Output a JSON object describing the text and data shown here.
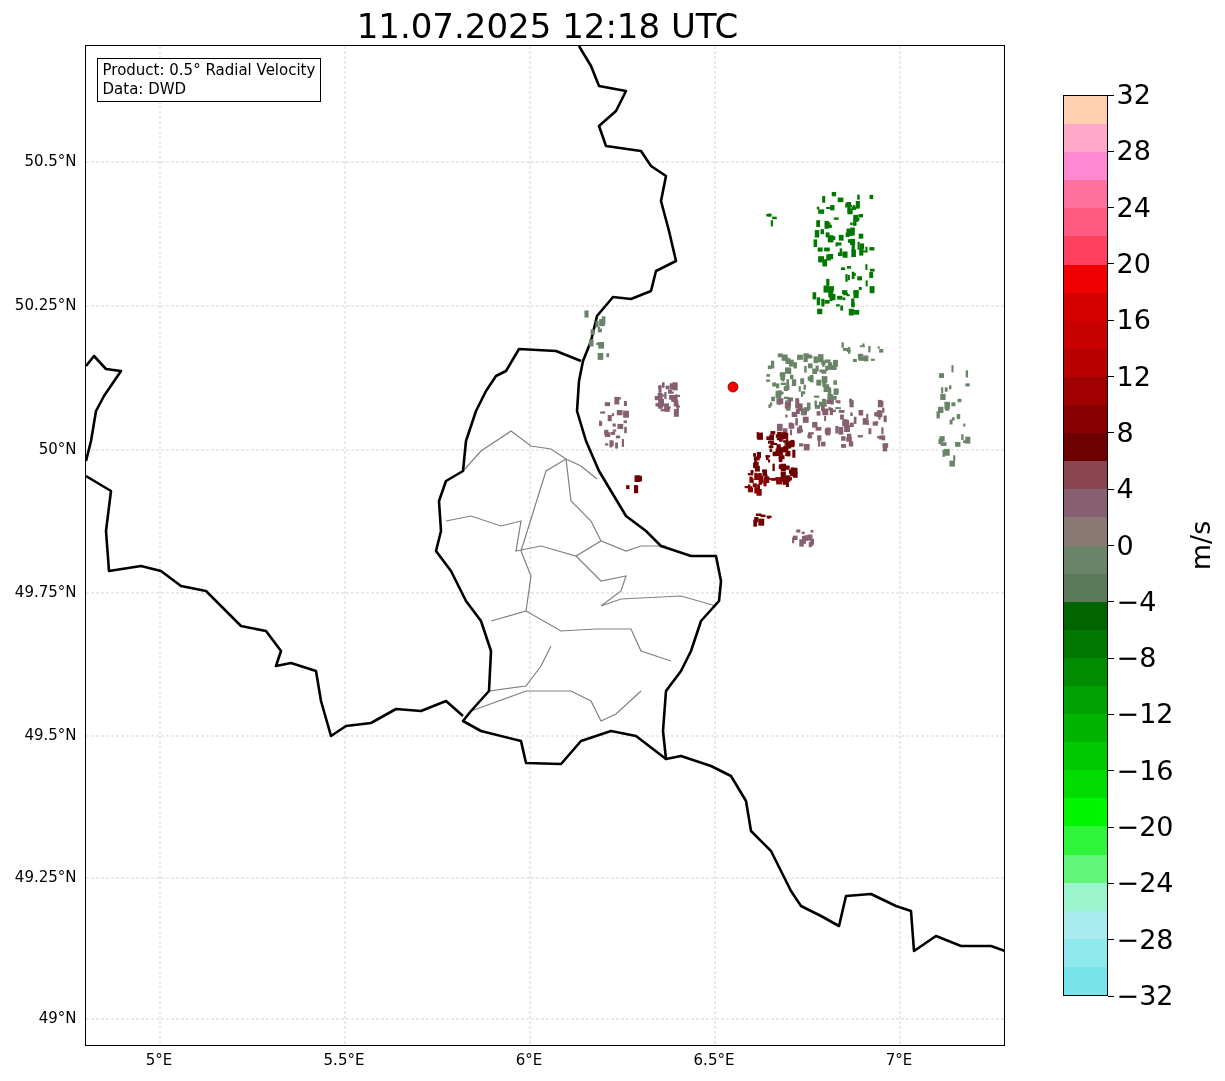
{
  "title": "11.07.2025 12:18 UTC",
  "map": {
    "info_box": [
      "Product: 0.5° Radial Velocity",
      "Data: DWD"
    ],
    "y_ticks": [
      "50.5°N",
      "50.25°N",
      "50°N",
      "49.75°N",
      "49.5°N",
      "49.25°N",
      "49°N"
    ],
    "x_ticks": [
      "5°E",
      "5.5°E",
      "6°E",
      "6.5°E",
      "7°E"
    ]
  },
  "colorbar": {
    "label": "m/s",
    "ticks": [
      "32",
      "28",
      "24",
      "20",
      "16",
      "12",
      "8",
      "4",
      "0",
      "−4",
      "−8",
      "−12",
      "−16",
      "−20",
      "−24",
      "−28",
      "−32"
    ],
    "bands": [
      {
        "color": "#ffd0b0"
      },
      {
        "color": "#ffa8c8"
      },
      {
        "color": "#ff88d0"
      },
      {
        "color": "#ff72a0"
      },
      {
        "color": "#ff5a80"
      },
      {
        "color": "#ff4060"
      },
      {
        "color": "#f00000"
      },
      {
        "color": "#d60000"
      },
      {
        "color": "#c80000"
      },
      {
        "color": "#b80000"
      },
      {
        "color": "#a00000"
      },
      {
        "color": "#880000"
      },
      {
        "color": "#6e0000"
      },
      {
        "color": "#8a4650"
      },
      {
        "color": "#866070"
      },
      {
        "color": "#8a7874"
      },
      {
        "color": "#6a8468"
      },
      {
        "color": "#5a7a5a"
      },
      {
        "color": "#006400"
      },
      {
        "color": "#007800"
      },
      {
        "color": "#008c00"
      },
      {
        "color": "#00a000"
      },
      {
        "color": "#00b400"
      },
      {
        "color": "#00c800"
      },
      {
        "color": "#00dc00"
      },
      {
        "color": "#00f500"
      },
      {
        "color": "#2ff53a"
      },
      {
        "color": "#62f57a"
      },
      {
        "color": "#9af5cc"
      },
      {
        "color": "#a8eaee"
      },
      {
        "color": "#8ee8ec"
      },
      {
        "color": "#76e4e8"
      }
    ]
  }
}
